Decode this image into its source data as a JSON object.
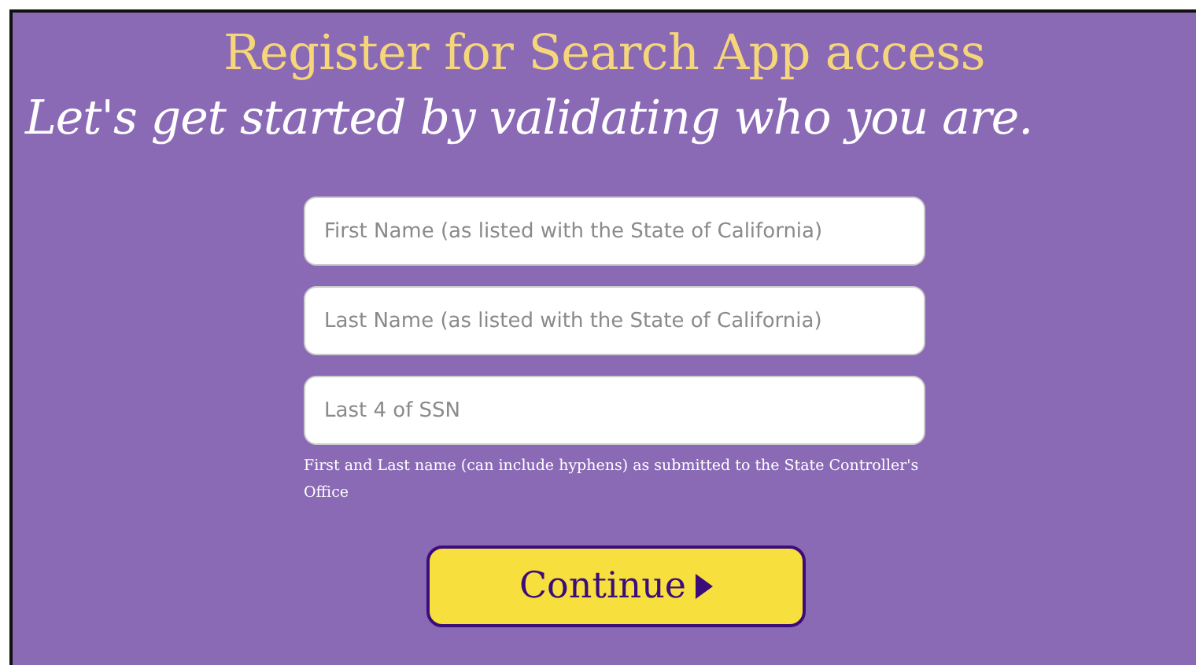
{
  "title": "Register for Search App access",
  "subtitle": "Let's get started by validating who you are.",
  "fields": [
    {
      "placeholder": "First Name (as listed with the State of California)"
    },
    {
      "placeholder": "Last Name (as listed with the State of California)"
    },
    {
      "placeholder": "Last 4 of SSN"
    }
  ],
  "hint": "First and Last name (can include hyphens) as submitted to the State Controller's Office",
  "button": {
    "label": "Continue"
  }
}
